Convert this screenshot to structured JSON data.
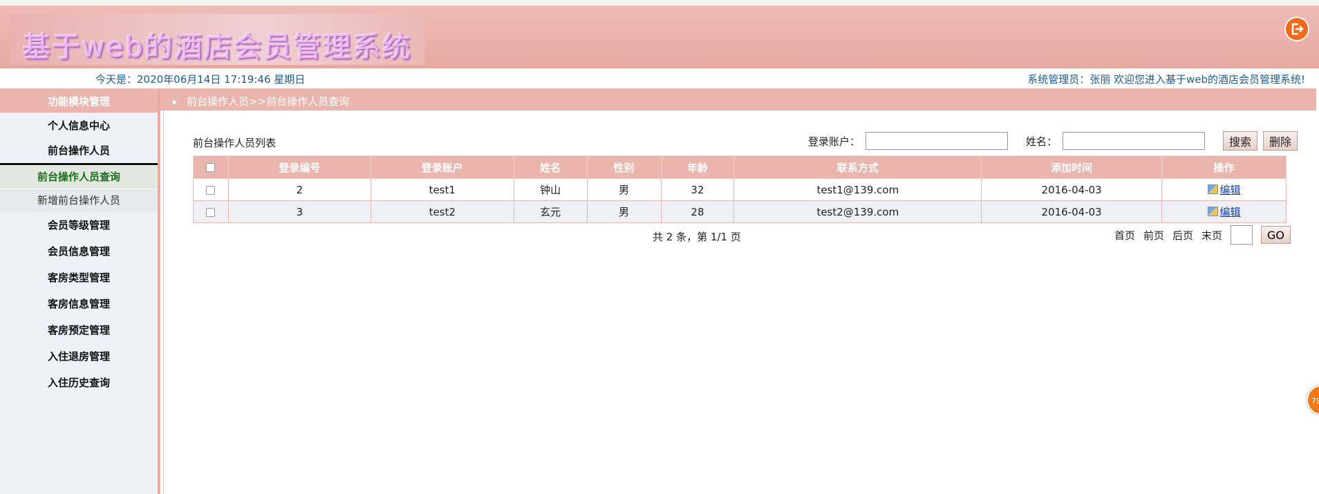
{
  "header": {
    "title": "基于web的酒店会员管理系统",
    "date_text": "今天是：2020年06月14日   17:19:46   星期日",
    "welcome_text": "系统管理员：张丽    欢迎您进入基于web的酒店会员管理系统!"
  },
  "sidebar": {
    "heading": "功能模块管理",
    "items": [
      {
        "label": "个人信息中心"
      },
      {
        "label": "前台操作人员",
        "subitems": [
          {
            "label": "前台操作人员查询",
            "active": true
          },
          {
            "label": "新增前台操作人员",
            "active": false
          }
        ]
      },
      {
        "label": "会员等级管理"
      },
      {
        "label": "会员信息管理"
      },
      {
        "label": "客房类型管理"
      },
      {
        "label": "客房信息管理"
      },
      {
        "label": "客房预定管理"
      },
      {
        "label": "入住退房管理"
      },
      {
        "label": "入住历史查询"
      }
    ]
  },
  "breadcrumb": "前台操作人员>>前台操作人员查询",
  "main": {
    "list_title": "前台操作人员列表",
    "search": {
      "account_label": "登录账户：",
      "account_value": "",
      "name_label": "姓名：",
      "name_value": "",
      "search_button": "搜索",
      "delete_button": "删除"
    },
    "table": {
      "headers": [
        "登录编号",
        "登录账户",
        "姓名",
        "性别",
        "年龄",
        "联系方式",
        "添加时间",
        "操作"
      ],
      "rows": [
        {
          "id": "2",
          "account": "test1",
          "name": "钟山",
          "gender": "男",
          "age": "32",
          "contact": "test1@139.com",
          "added": "2016-04-03",
          "action": "编辑"
        },
        {
          "id": "3",
          "account": "test2",
          "name": "玄元",
          "gender": "男",
          "age": "28",
          "contact": "test2@139.com",
          "added": "2016-04-03",
          "action": "编辑"
        }
      ]
    },
    "pager": {
      "summary": "共 2 条，第 1/1 页",
      "first": "首页",
      "prev": "前页",
      "next": "后页",
      "last": "末页",
      "page_value": "",
      "go": "GO"
    }
  },
  "float_badge": "78",
  "colors": {
    "header_pink": "#e9b5ad",
    "link_blue": "#1b5c95",
    "logout_orange": "#f06a1a"
  }
}
